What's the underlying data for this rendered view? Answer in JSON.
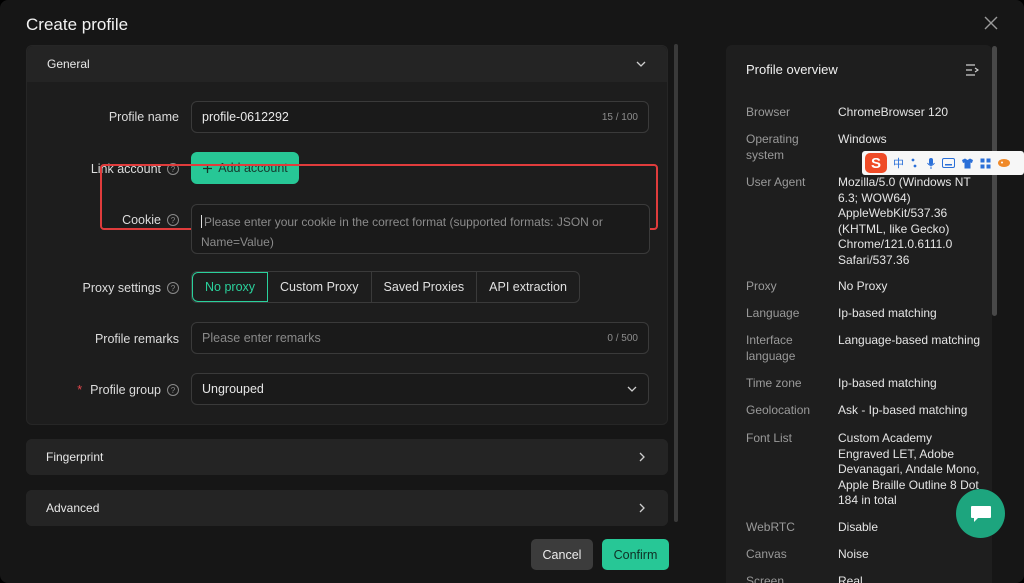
{
  "dialog": {
    "title": "Create profile"
  },
  "general": {
    "header": "General",
    "profile_name": {
      "label": "Profile name",
      "value": "profile-0612292",
      "counter": "15 / 100"
    },
    "link_account": {
      "label": "Link account",
      "button": "Add account"
    },
    "cookie": {
      "label": "Cookie",
      "placeholder": "Please enter your cookie in the correct format (supported formats: JSON or Name=Value)"
    },
    "proxy": {
      "label": "Proxy settings",
      "options": [
        "No proxy",
        "Custom Proxy",
        "Saved Proxies",
        "API extraction"
      ],
      "selected": "No proxy"
    },
    "remarks": {
      "label": "Profile remarks",
      "placeholder": "Please enter remarks",
      "counter": "0 / 500"
    },
    "group": {
      "label": "Profile group",
      "required_mark": "*",
      "value": "Ungrouped"
    }
  },
  "fingerprint": {
    "header": "Fingerprint"
  },
  "advanced": {
    "header": "Advanced"
  },
  "footer": {
    "cancel": "Cancel",
    "confirm": "Confirm"
  },
  "overview": {
    "title": "Profile overview",
    "rows": [
      {
        "key": "Browser",
        "value": "ChromeBrowser 120"
      },
      {
        "key": "Operating system",
        "value": "Windows"
      },
      {
        "key": "User Agent",
        "value": "Mozilla/5.0 (Windows NT 6.3; WOW64) AppleWebKit/537.36 (KHTML, like Gecko) Chrome/121.0.6111.0 Safari/537.36"
      },
      {
        "key": "Proxy",
        "value": "No Proxy"
      },
      {
        "key": "Language",
        "value": "Ip-based matching"
      },
      {
        "key": "Interface language",
        "value": "Language-based matching"
      },
      {
        "key": "Time zone",
        "value": "Ip-based matching"
      },
      {
        "key": "Geolocation",
        "value": "Ask - Ip-based matching"
      },
      {
        "key": "Font List",
        "value": "Custom Academy Engraved LET, Adobe Devanagari, Andale Mono, Apple Braille Outline 8 Dot 184 in total"
      },
      {
        "key": "WebRTC",
        "value": "Disable"
      },
      {
        "key": "Canvas",
        "value": "Noise"
      },
      {
        "key": "Screen",
        "value": "Real"
      }
    ]
  },
  "ime": {
    "logo": "S",
    "mode": "中"
  },
  "colors": {
    "accent": "#27c796",
    "highlight": "#e03c3c"
  }
}
